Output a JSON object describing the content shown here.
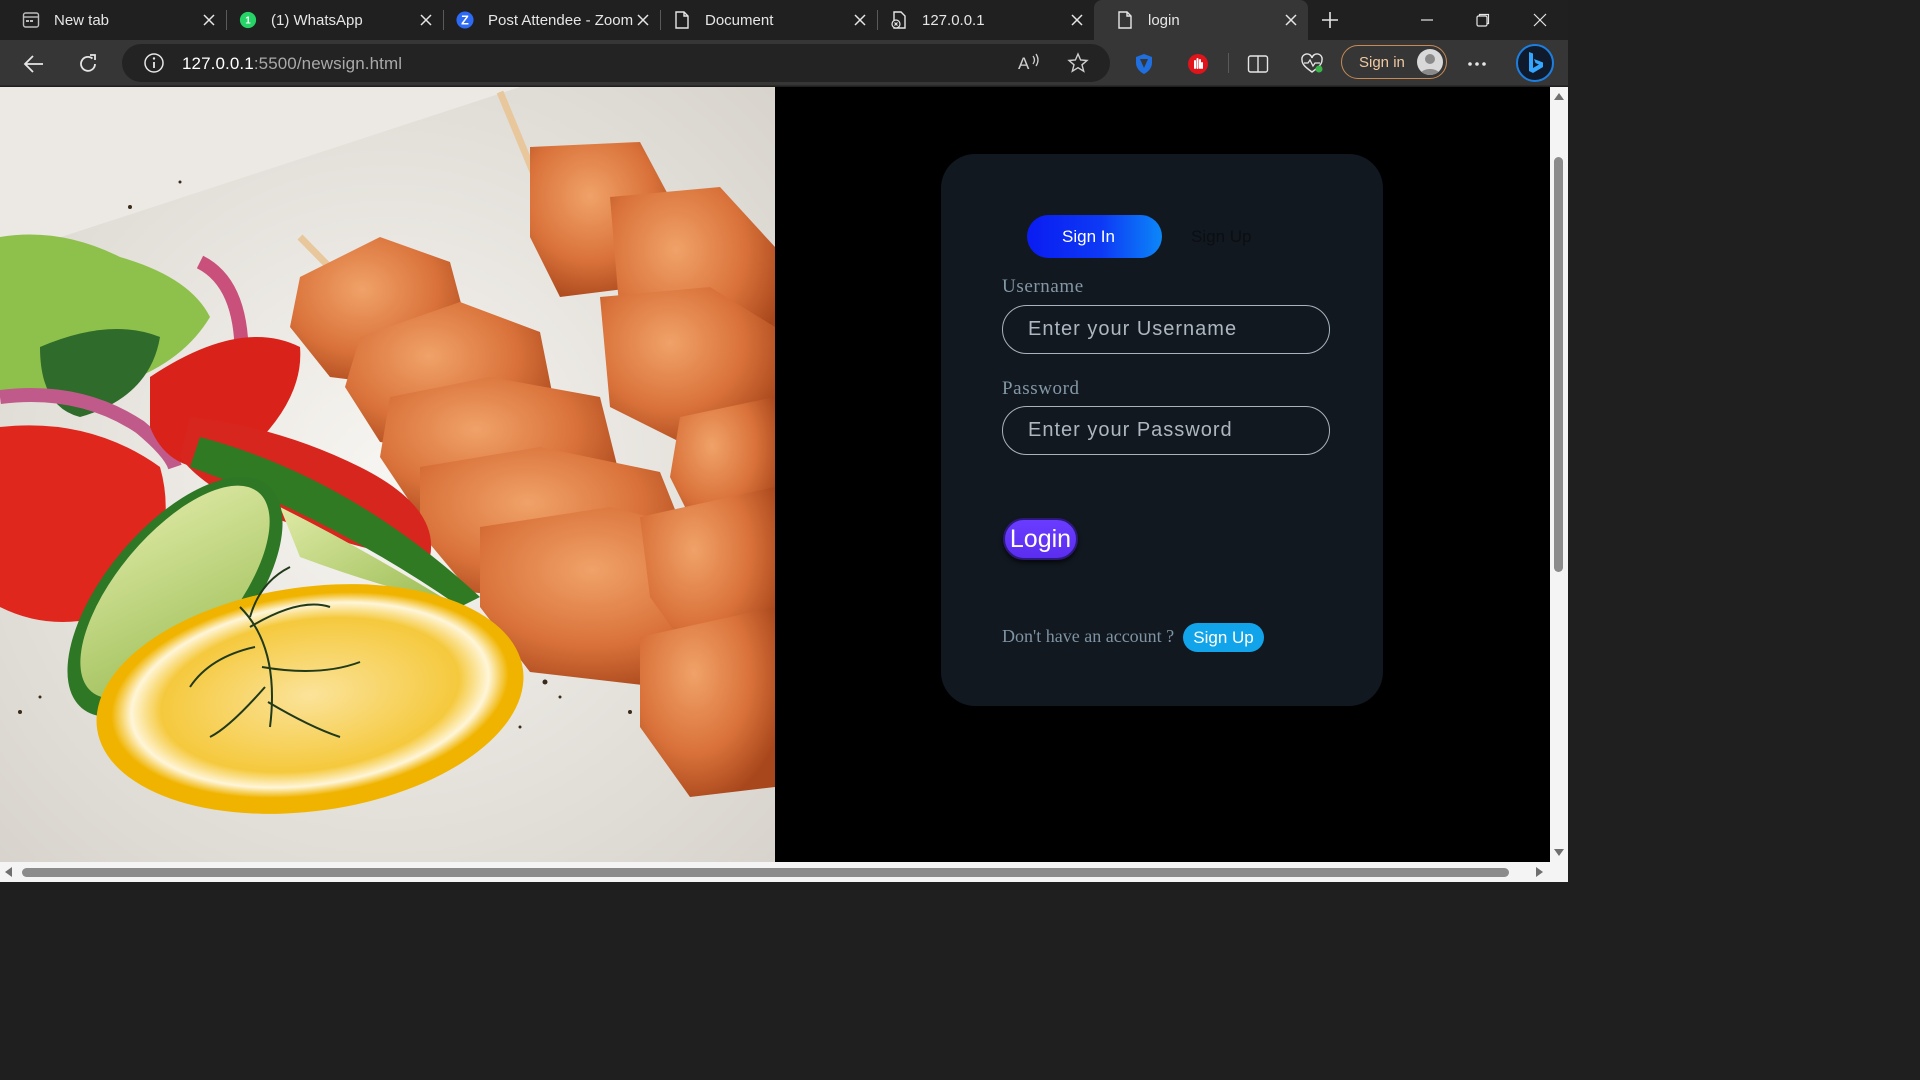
{
  "browser": {
    "tabs": [
      {
        "title": "New tab",
        "icon": "newtab-icon"
      },
      {
        "title": "(1) WhatsApp",
        "icon": "whatsapp-icon"
      },
      {
        "title": "Post Attendee - Zoom",
        "icon": "zoom-icon"
      },
      {
        "title": "Document",
        "icon": "document-icon"
      },
      {
        "title": "127.0.0.1",
        "icon": "file-error-icon"
      },
      {
        "title": "login",
        "icon": "document-icon",
        "active": true
      }
    ],
    "url_host": "127.0.0.1",
    "url_path": ":5500/newsign.html",
    "signin_label": "Sign in"
  },
  "page": {
    "toggle": {
      "signin": "Sign In",
      "signup": "Sign Up"
    },
    "username": {
      "label": "Username",
      "placeholder": "Enter your Username"
    },
    "password": {
      "label": "Password",
      "placeholder": "Enter your Password"
    },
    "login_label": "Login",
    "account_prompt": "Don't have an account ?",
    "signup_link": "Sign Up"
  },
  "colors": {
    "card_bg": "#111820",
    "toggle_gradient_start": "#0a1cf2",
    "toggle_gradient_end": "#0c87f8",
    "login_button": "#5b2df0",
    "signup_pill": "#11a4ea",
    "label_color": "#8497a6"
  }
}
